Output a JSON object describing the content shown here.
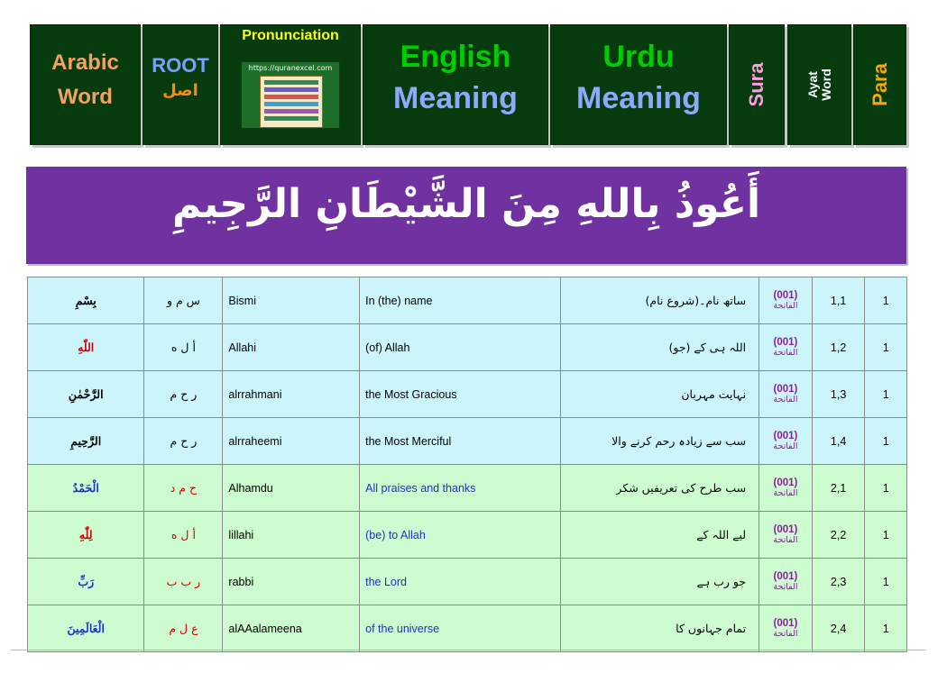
{
  "header": {
    "arabic_line1": "Arabic",
    "arabic_line2": "Word",
    "root_label": "ROOT",
    "root_arabic": "اصل",
    "pronunciation": "Pronunciation",
    "pron_url": "https://quranexcel.com",
    "english_line1": "English",
    "english_line2": "Meaning",
    "urdu_line1": "Urdu",
    "urdu_line2": "Meaning",
    "sura": "Sura",
    "ayat_line1": "Ayat",
    "ayat_line2": "Word",
    "para": "Para"
  },
  "banner": {
    "text": "أَعُوذُ بِاللهِ مِنَ الشَّيْطَانِ الرَّجِيمِ"
  },
  "rows": [
    {
      "arabic": "بِسْمِ",
      "root": "س م و",
      "pron": "Bismi",
      "english": "In (the) name",
      "urdu": "ساتھ نام۔(شروع نام)",
      "sura_num": "(001)",
      "sura_name": "الفاتحة",
      "ayat": "1,1",
      "para": "1"
    },
    {
      "arabic": "اللّٰهِ",
      "root": "أ ل ه",
      "pron": "Allahi",
      "english": "(of) Allah",
      "urdu": "اللہ ہی کے (جو)",
      "sura_num": "(001)",
      "sura_name": "الفاتحة",
      "ayat": "1,2",
      "para": "1"
    },
    {
      "arabic": "الرَّحْمٰنِ",
      "root": "ر ح م",
      "pron": "alrrahmani",
      "english": "the Most Gracious",
      "urdu": "نہایت مہربان",
      "sura_num": "(001)",
      "sura_name": "الفاتحة",
      "ayat": "1,3",
      "para": "1"
    },
    {
      "arabic": "الرَّحِيمِ",
      "root": "ر ح م",
      "pron": "alrraheemi",
      "english": "the Most Merciful",
      "urdu": "سب سے زیادہ رحم کرنے والا",
      "sura_num": "(001)",
      "sura_name": "الفاتحة",
      "ayat": "1,4",
      "para": "1"
    },
    {
      "arabic": "الْحَمْدُ",
      "root": "ح م د",
      "pron": "Alhamdu",
      "english": "All praises and thanks",
      "urdu": "سب طرح کی تعریفیں شکر",
      "sura_num": "(001)",
      "sura_name": "الفاتحة",
      "ayat": "2,1",
      "para": "1"
    },
    {
      "arabic": "لِلّٰهِ",
      "root": "أ ل ه",
      "pron": "lillahi",
      "english": "(be) to Allah",
      "urdu": "لیے اللہ کے",
      "sura_num": "(001)",
      "sura_name": "الفاتحة",
      "ayat": "2,2",
      "para": "1"
    },
    {
      "arabic": "رَبِّ",
      "root": "ر ب ب",
      "pron": "rabbi",
      "english": "the Lord",
      "urdu": "جو رب ہے",
      "sura_num": "(001)",
      "sura_name": "الفاتحة",
      "ayat": "2,3",
      "para": "1"
    },
    {
      "arabic": "الْعَالَمِينَ",
      "root": "ع ل م",
      "pron": "alAAalameena",
      "english": "of the universe",
      "urdu": "تمام جہانوں کا",
      "sura_num": "(001)",
      "sura_name": "الفاتحة",
      "ayat": "2,4",
      "para": "1"
    }
  ],
  "colors": {
    "header_bg": "#063b0e",
    "banner_bg": "#7032a0",
    "row_blue": "#ccf5fb",
    "row_green": "#ccfccf",
    "arabic_header": "#f4a261",
    "english_header": "#00cc00",
    "meaning_header": "#8fa8ff",
    "sura_color": "#ff9ee0",
    "para_color": "#f5a800"
  }
}
